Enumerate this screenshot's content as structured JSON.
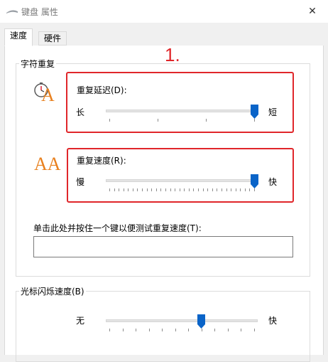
{
  "window": {
    "title": "键盘 属性",
    "close_glyph": "✕"
  },
  "tabs": [
    {
      "label": "速度",
      "active": true
    },
    {
      "label": "硬件",
      "active": false
    }
  ],
  "annotation": "1.",
  "char_repeat": {
    "group_title": "字符重复",
    "delay": {
      "label": "重复延迟(D):",
      "min_label": "长",
      "max_label": "短",
      "position": 3,
      "steps": 3
    },
    "rate": {
      "label": "重复速度(R):",
      "min_label": "慢",
      "max_label": "快",
      "position": 31,
      "steps": 31
    },
    "test_label": "单击此处并按住一个键以便测试重复速度(T):",
    "test_value": "",
    "rate_icon_text": "AA",
    "delay_icon_text": "A"
  },
  "cursor_blink": {
    "group_title": "光标闪烁速度(B)",
    "min_label": "无",
    "max_label": "快",
    "position": 7,
    "steps": 11
  },
  "colors": {
    "accent_thumb": "#0a64c8",
    "highlight_red": "#e0262a",
    "icon_orange": "#e8801e"
  }
}
